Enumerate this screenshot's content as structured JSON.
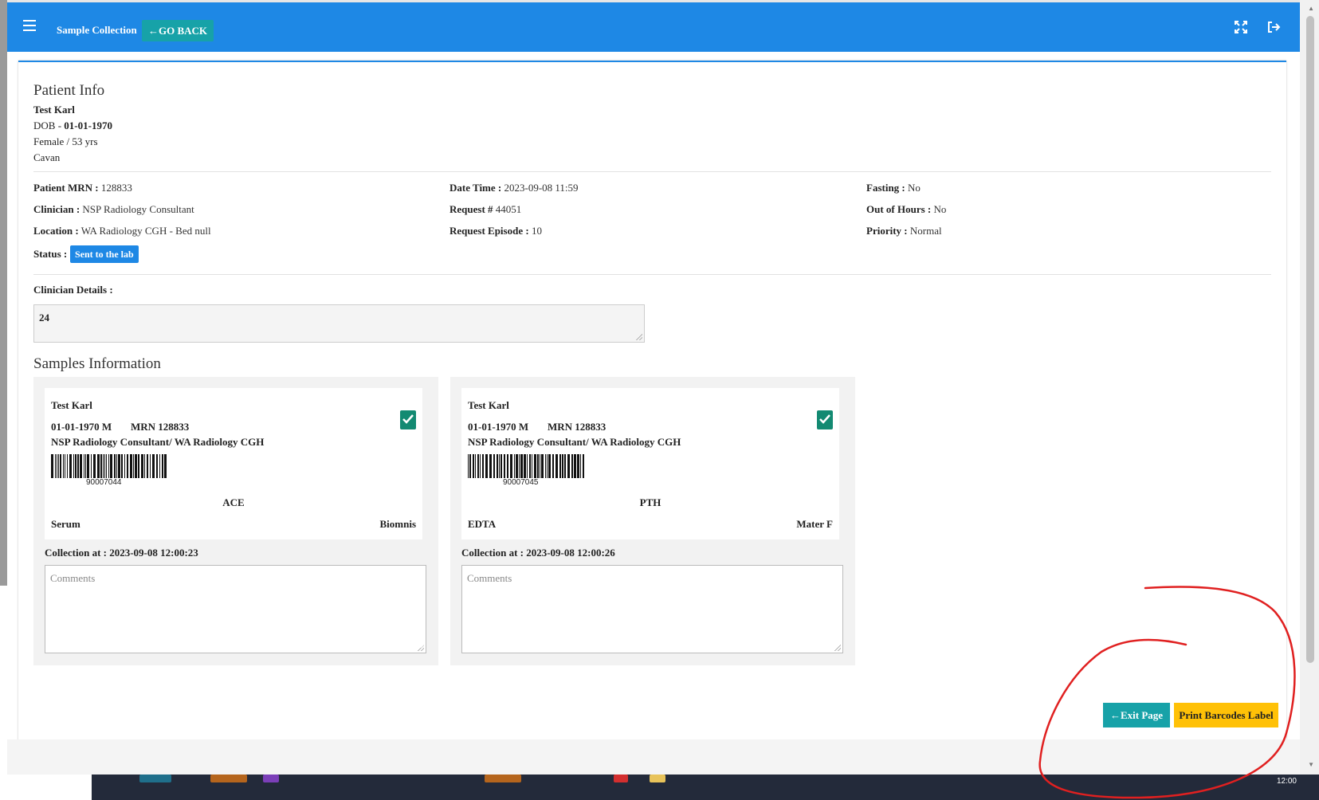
{
  "header": {
    "menu_icon": "hamburger-icon",
    "title": "Sample Collection",
    "go_back_label": "GO BACK",
    "fullscreen_icon": "expand-icon",
    "logout_icon": "sign-out-icon",
    "bg_color": "#1e88e5"
  },
  "patient": {
    "section_title": "Patient Info",
    "name": "Test Karl",
    "dob_label": "DOB - ",
    "dob": "01-01-1970",
    "gender_age": "Female / 53 yrs",
    "county": "Cavan"
  },
  "details": {
    "mrn_label": "Patient MRN :",
    "mrn": "128833",
    "clinician_label": "Clinician :",
    "clinician": "NSP Radiology Consultant",
    "location_label": "Location :",
    "location": "WA Radiology CGH - Bed null",
    "status_label": "Status :",
    "status": "Sent to the lab",
    "datetime_label": "Date Time :",
    "datetime": "2023-09-08 11:59",
    "request_label": "Request #",
    "request": "44051",
    "episode_label": "Request Episode :",
    "episode": "10",
    "fasting_label": "Fasting :",
    "fasting": "No",
    "ooh_label": "Out of Hours :",
    "ooh": "No",
    "priority_label": "Priority :",
    "priority": "Normal"
  },
  "clinician_details": {
    "label": "Clinician Details :",
    "value": "24"
  },
  "samples_title": "Samples Information",
  "samples": [
    {
      "name": "Test Karl",
      "dob_sex": "01-01-1970 M",
      "mrn": "MRN 128833",
      "clinician_location": "NSP Radiology Consultant/ WA Radiology CGH",
      "barcode": "90007044",
      "test": "ACE",
      "type": "Serum",
      "lab": "Biomnis",
      "collection": "Collection at : 2023-09-08 12:00:23",
      "comments_placeholder": "Comments",
      "checked": true
    },
    {
      "name": "Test Karl",
      "dob_sex": "01-01-1970 M",
      "mrn": "MRN 128833",
      "clinician_location": "NSP Radiology Consultant/ WA Radiology CGH",
      "barcode": "90007045",
      "test": "PTH",
      "type": "EDTA",
      "lab": "Mater F",
      "collection": "Collection at : 2023-09-08 12:00:26",
      "comments_placeholder": "Comments",
      "checked": true
    }
  ],
  "actions": {
    "exit_label": "Exit Page",
    "print_label": "Print Barcodes Label"
  },
  "taskbar": {
    "clock": "12:00"
  },
  "colors": {
    "teal": "#17a2a8",
    "yellow": "#ffc107",
    "check_green": "#138a72",
    "annotation_red": "#e02020"
  }
}
